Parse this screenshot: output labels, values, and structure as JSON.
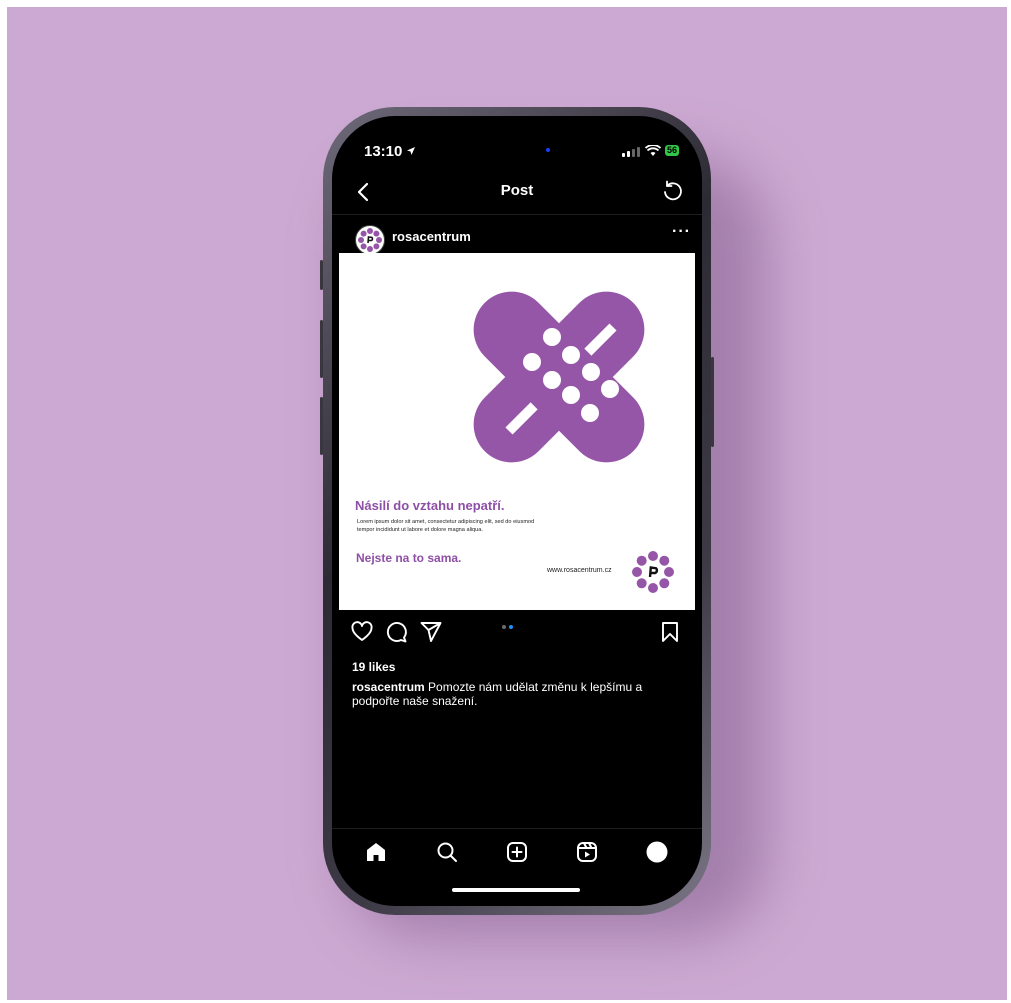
{
  "status_bar": {
    "time": "13:10",
    "battery": "56"
  },
  "header": {
    "title": "Post"
  },
  "post": {
    "username": "rosacentrum",
    "image": {
      "headline": "Násilí do vztahu nepatří.",
      "body": "Lorem ipsum dolor sit amet, consectetur adipiscing elit, sed do eiusmod tempor incididunt ut labore et dolore magna aliqua.",
      "tagline": "Nejste na to sama.",
      "website": "www.rosacentrum.cz"
    },
    "carousel": {
      "count": 2,
      "active": 2
    },
    "likes": "19 likes",
    "caption_user": "rosacentrum",
    "caption_text": "Pomozte nám udělat změnu k lepšímu a podpořte naše snažení."
  },
  "colors": {
    "background": "#cca9d2",
    "brand_purple": "#9656a8",
    "accent_blue": "#1f8ef1"
  },
  "icons": {
    "header": [
      "back-icon",
      "refresh-icon",
      "more-icon"
    ],
    "actions": [
      "heart-icon",
      "comment-icon",
      "share-icon",
      "bookmark-icon"
    ],
    "tabs": [
      "home-icon",
      "search-icon",
      "create-icon",
      "reels-icon",
      "profile-icon"
    ]
  }
}
